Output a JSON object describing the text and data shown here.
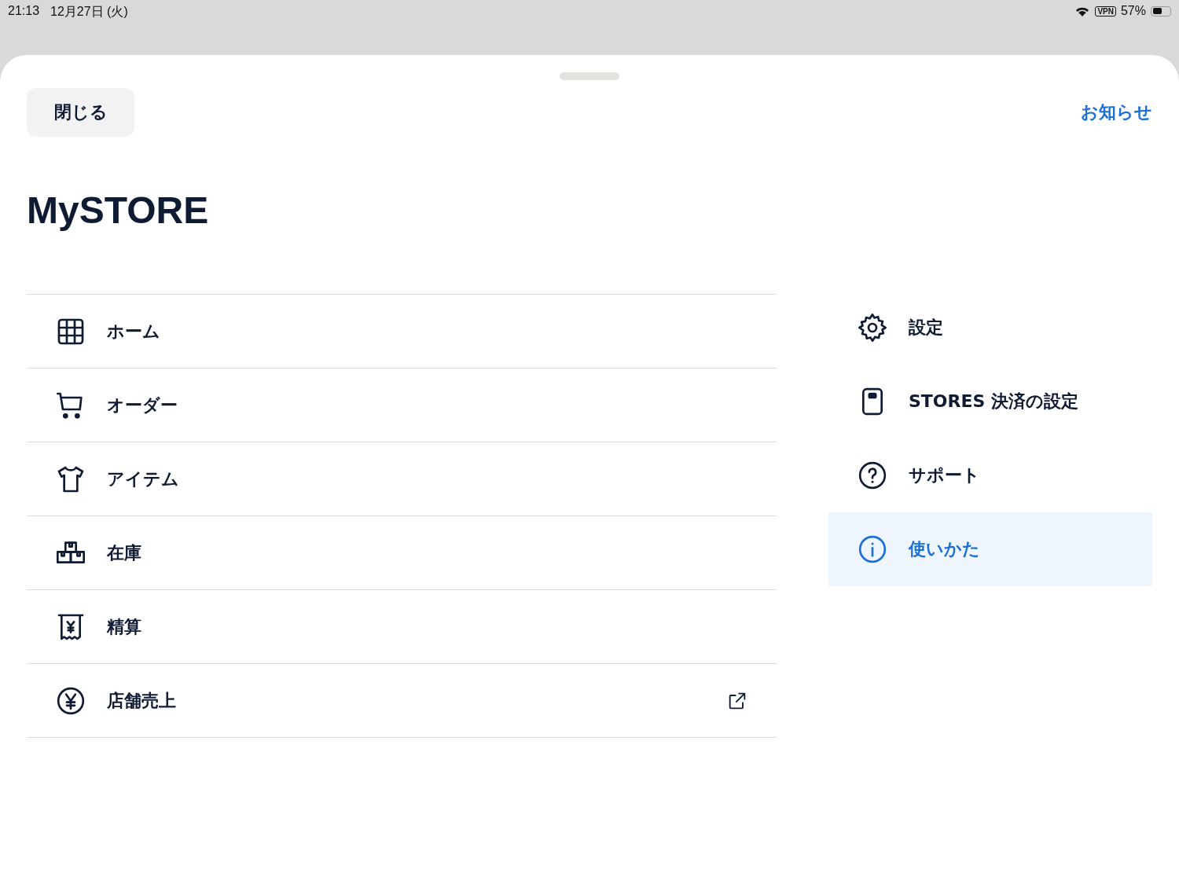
{
  "status_bar": {
    "time": "21:13",
    "date": "12月27日 (火)",
    "vpn": "VPN",
    "battery": "57%"
  },
  "header": {
    "close_button": "閉じる",
    "news_link": "お知らせ"
  },
  "title": "MySTORE",
  "main_menu": [
    {
      "label": "ホーム",
      "external": false
    },
    {
      "label": "オーダー",
      "external": false
    },
    {
      "label": "アイテム",
      "external": false
    },
    {
      "label": "在庫",
      "external": false
    },
    {
      "label": "精算",
      "external": false
    },
    {
      "label": "店舗売上",
      "external": true
    }
  ],
  "side_menu": [
    {
      "label": "設定",
      "selected": false
    },
    {
      "label": "STORES 決済の設定",
      "selected": false
    },
    {
      "label": "サポート",
      "selected": false
    },
    {
      "label": "使いかた",
      "selected": true
    }
  ]
}
